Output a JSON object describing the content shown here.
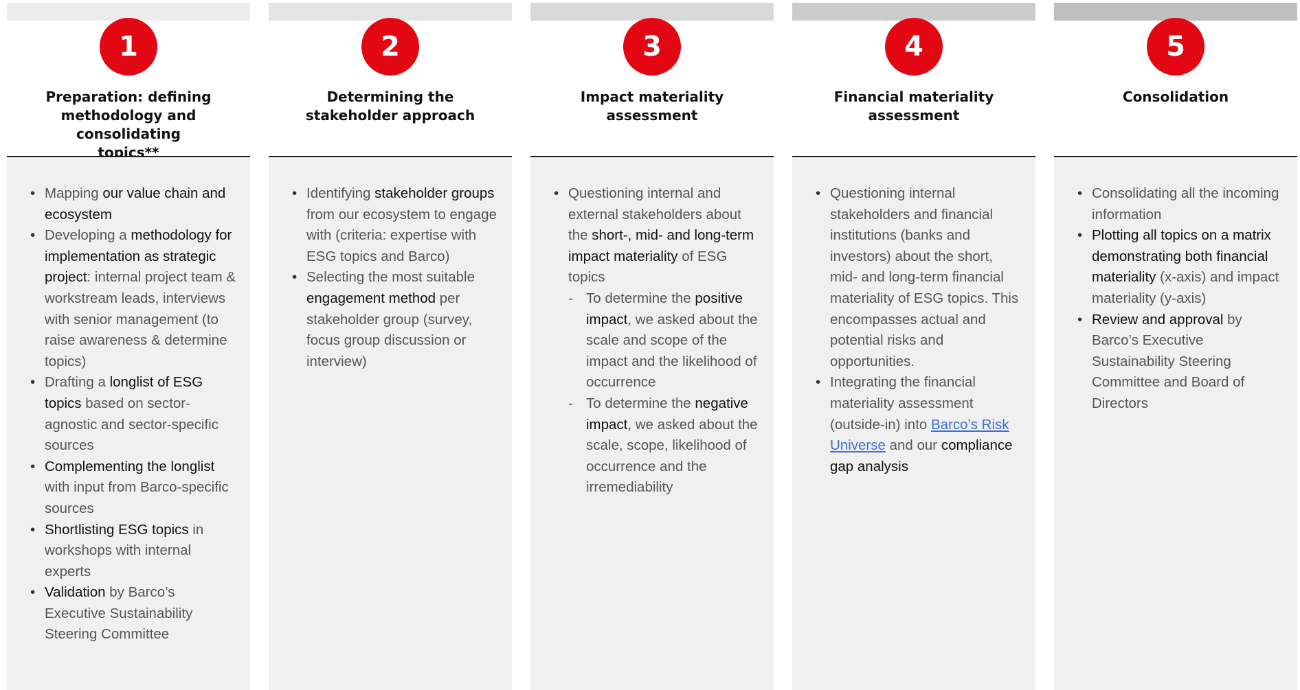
{
  "accent_color": "#e30613",
  "steps": [
    {
      "number": "1",
      "bar_color": "#ececec",
      "title_lines": [
        "Preparation: defining",
        "methodology and consolidating",
        "topics**"
      ],
      "items": [
        {
          "runs": [
            {
              "t": "Mapping "
            },
            {
              "t": "our value chain and ecosystem",
              "b": true
            }
          ]
        },
        {
          "runs": [
            {
              "t": "Developing a "
            },
            {
              "t": "methodology for implementation as strategic project",
              "b": true
            },
            {
              "t": ": internal project team & workstream leads, interviews with senior management (to raise awareness & determine topics)"
            }
          ]
        },
        {
          "runs": [
            {
              "t": "Drafting a "
            },
            {
              "t": "longlist of ESG topics",
              "b": true
            },
            {
              "t": " based on sector-agnostic and sector-specific sources"
            }
          ]
        },
        {
          "runs": [
            {
              "t": "Complementing the longlist",
              "b": true
            },
            {
              "t": " with input from Barco-specific sources"
            }
          ]
        },
        {
          "runs": [
            {
              "t": "Shortlisting ESG topics",
              "b": true
            },
            {
              "t": " in workshops with internal experts"
            }
          ]
        },
        {
          "runs": [
            {
              "t": "Validation",
              "b": true
            },
            {
              "t": " by Barco’s Executive Sustainability Steering Committee"
            }
          ]
        }
      ]
    },
    {
      "number": "2",
      "bar_color": "#e4e4e4",
      "title_lines": [
        "Determining the",
        "stakeholder approach"
      ],
      "items": [
        {
          "runs": [
            {
              "t": "Identifying "
            },
            {
              "t": "stakeholder groups",
              "b": true
            },
            {
              "t": " from our ecosystem to engage with (criteria: expertise with ESG topics and Barco)"
            }
          ]
        },
        {
          "runs": [
            {
              "t": "Selecting the most suitable "
            },
            {
              "t": "engagement method",
              "b": true
            },
            {
              "t": " per stakeholder group (survey, focus group discussion or interview)"
            }
          ]
        }
      ]
    },
    {
      "number": "3",
      "bar_color": "#d9d9d9",
      "title_lines": [
        "Impact materiality",
        "assessment"
      ],
      "items": [
        {
          "runs": [
            {
              "t": "Questioning internal and external stakeholders about the "
            },
            {
              "t": "short-, mid- and long-term impact materiality",
              "b": true
            },
            {
              "t": " of ESG topics"
            }
          ],
          "sub": [
            {
              "runs": [
                {
                  "t": "To determine the "
                },
                {
                  "t": "positive impact",
                  "b": true
                },
                {
                  "t": ", we asked about the scale and scope of the impact and the likelihood of occurrence"
                }
              ]
            },
            {
              "runs": [
                {
                  "t": "To determine the "
                },
                {
                  "t": "negative impact",
                  "b": true
                },
                {
                  "t": ", we asked about the scale, scope, likelihood of occurrence and the irremediability"
                }
              ]
            }
          ]
        }
      ]
    },
    {
      "number": "4",
      "bar_color": "#cccccc",
      "title_lines": [
        "Financial materiality",
        "assessment"
      ],
      "items": [
        {
          "runs": [
            {
              "t": "Questioning internal stakeholders and financial institutions (banks and investors) about the short, mid- and long-term financial materiality of ESG topics. This encompasses actual and potential risks and opportunities."
            }
          ]
        },
        {
          "runs": [
            {
              "t": "Integrating the financial materiality assessment (outside-in) into "
            },
            {
              "t": "Barco’s Risk Universe",
              "link": true
            },
            {
              "t": " and our "
            },
            {
              "t": "compliance gap analysis",
              "b": true
            }
          ]
        }
      ]
    },
    {
      "number": "5",
      "bar_color": "#bfbfbf",
      "title_lines": [
        "Consolidation"
      ],
      "items": [
        {
          "runs": [
            {
              "t": "Consolidating all the incoming information"
            }
          ]
        },
        {
          "runs": [
            {
              "t": "Plotting all topics on a matrix demonstrating both financial materiality",
              "b": true
            },
            {
              "t": " (x-axis) and impact materiality (y-axis)"
            }
          ]
        },
        {
          "runs": [
            {
              "t": "Review and approval",
              "b": true
            },
            {
              "t": " by Barco’s Executive Sustainability Steering Committee and Board of Directors"
            }
          ]
        }
      ]
    }
  ]
}
